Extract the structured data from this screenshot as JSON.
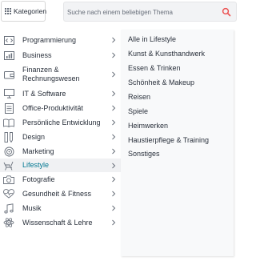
{
  "header": {
    "categories_label": "Kategorien",
    "search_placeholder": "Suche nach einem beliebigen Thema"
  },
  "colors": {
    "accent": "#007791",
    "search_icon": "#ec5252",
    "text": "#29303b",
    "active_bg": "#f0f1f3",
    "submenu_bg": "#f8f9fa"
  },
  "categories": [
    {
      "label": "Programmierung",
      "icon": "code-icon"
    },
    {
      "label": "Business",
      "icon": "chart-icon"
    },
    {
      "label": "Finanzen & Rechnungswesen",
      "line1": "Finanzen &",
      "line2": "Rechnungswesen",
      "icon": "wallet-icon"
    },
    {
      "label": "IT & Software",
      "icon": "monitor-icon"
    },
    {
      "label": "Office-Produktivität",
      "icon": "document-icon"
    },
    {
      "label": "Persönliche Entwicklung",
      "icon": "book-icon"
    },
    {
      "label": "Design",
      "icon": "pencil-icon"
    },
    {
      "label": "Marketing",
      "icon": "target-icon"
    },
    {
      "label": "Lifestyle",
      "icon": "lounge-chair-icon",
      "active": true
    },
    {
      "label": "Fotografie",
      "icon": "camera-icon"
    },
    {
      "label": "Gesundheit & Fitness",
      "icon": "heart-pulse-icon"
    },
    {
      "label": "Musik",
      "icon": "music-note-icon"
    },
    {
      "label": "Wissenschaft & Lehre",
      "icon": "atom-icon"
    }
  ],
  "submenu": [
    "Alle in Lifestyle",
    "Kunst & Kunsthandwerk",
    "Essen & Trinken",
    "Schönheit & Makeup",
    "Reisen",
    "Spiele",
    "Heimwerken",
    "Haustierpflege & Training",
    "Sonstiges"
  ]
}
